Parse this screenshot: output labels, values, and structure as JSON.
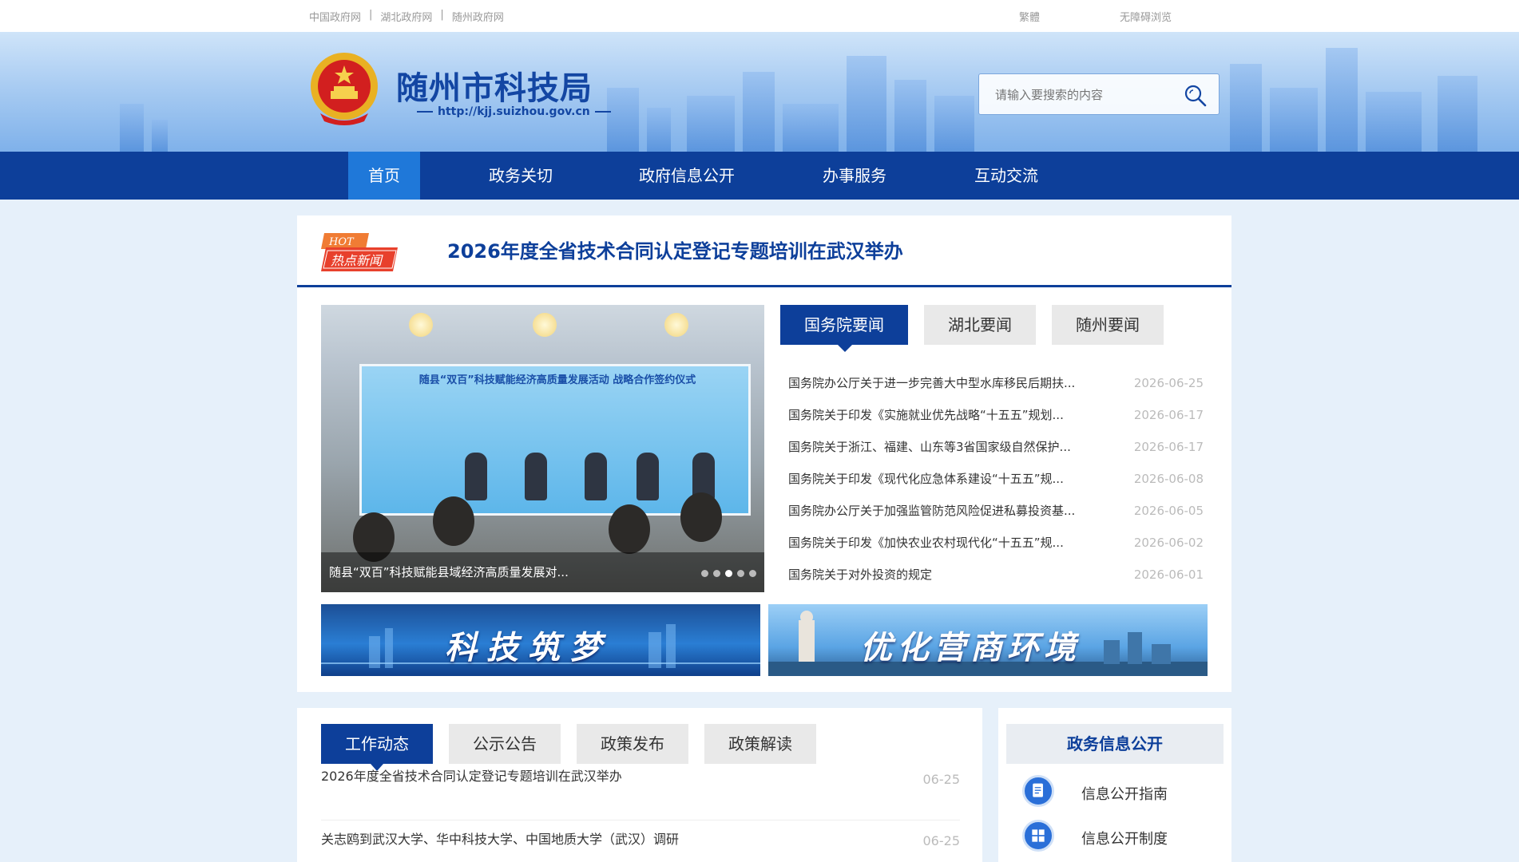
{
  "topbar": {
    "links": [
      "中国政府网",
      "湖北政府网",
      "随州政府网"
    ],
    "traditional": "繁體",
    "accessible": "无障碍浏览"
  },
  "header": {
    "title": "随州市科技局",
    "url": "http://kjj.suizhou.gov.cn",
    "search_placeholder": "请输入要搜索的内容"
  },
  "nav": {
    "items": [
      "首页",
      "政务关切",
      "政府信息公开",
      "办事服务",
      "互动交流"
    ],
    "active_index": 0
  },
  "hot": {
    "badge_top": "HOT",
    "badge_bottom": "热点新闻",
    "title": "2026年度全省技术合同认定登记专题培训在武汉举办"
  },
  "slideshow": {
    "screen_text": "随县“双百”科技赋能经济高质量发展活动  战略合作签约仪式",
    "caption": "随县“双百”科技赋能县域经济高质量发展对...",
    "dot_count": 5,
    "active_dot": 2
  },
  "news": {
    "tabs": [
      "国务院要闻",
      "湖北要闻",
      "随州要闻"
    ],
    "active_tab": 0,
    "items": [
      {
        "title": "国务院办公厅关于进一步完善大中型水库移民后期扶...",
        "date": "2026-06-25"
      },
      {
        "title": "国务院关于印发《实施就业优先战略“十五五”规划...",
        "date": "2026-06-17"
      },
      {
        "title": "国务院关于浙江、福建、山东等3省国家级自然保护...",
        "date": "2026-06-17"
      },
      {
        "title": "国务院关于印发《现代化应急体系建设“十五五”规...",
        "date": "2026-06-08"
      },
      {
        "title": "国务院办公厅关于加强监管防范风险促进私募投资基...",
        "date": "2026-06-05"
      },
      {
        "title": "国务院关于印发《加快农业农村现代化“十五五”规...",
        "date": "2026-06-02"
      },
      {
        "title": "国务院关于对外投资的规定",
        "date": "2026-06-01"
      }
    ]
  },
  "banners": {
    "left": "科技筑梦",
    "right": "优化营商环境"
  },
  "work": {
    "tabs": [
      "工作动态",
      "公示公告",
      "政策发布",
      "政策解读"
    ],
    "active_tab": 0,
    "items": [
      {
        "title": "2026年度全省技术合同认定登记专题培训在武汉举办",
        "date": "06-25"
      },
      {
        "title": "关志鸥到武汉大学、华中科技大学、中国地质大学（武汉）调研",
        "date": "06-25"
      }
    ]
  },
  "info_open": {
    "title": "政务信息公开",
    "links": [
      {
        "label": "信息公开指南",
        "icon": "document-icon"
      },
      {
        "label": "信息公开制度",
        "icon": "grid-icon"
      }
    ]
  },
  "colors": {
    "primary": "#0d3f9a",
    "nav_active": "#1f78d9",
    "page_bg": "#e6f0fa",
    "hot_badge": "#e8532c"
  }
}
